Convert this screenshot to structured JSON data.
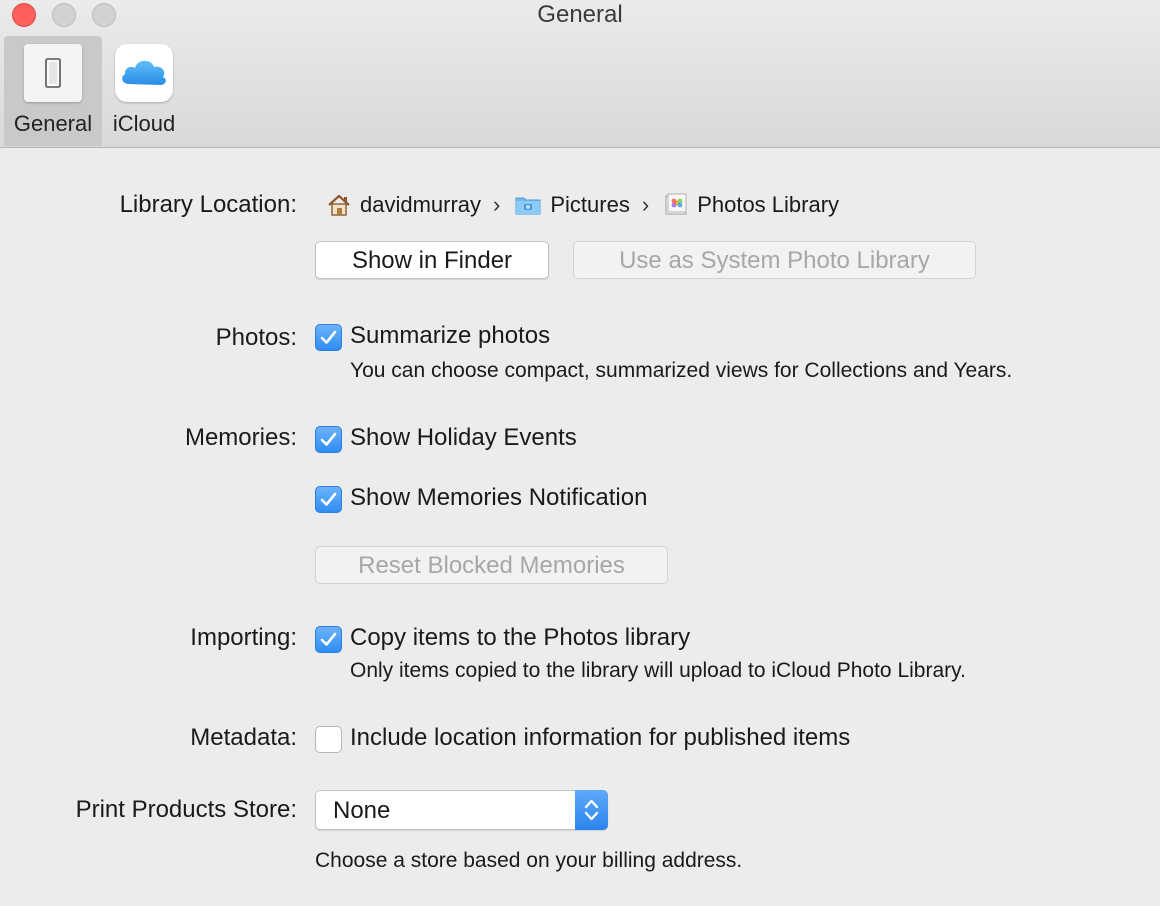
{
  "window": {
    "title": "General"
  },
  "toolbar": {
    "items": [
      {
        "label": "General",
        "icon": "switch-icon",
        "selected": true
      },
      {
        "label": "iCloud",
        "icon": "icloud-icon",
        "selected": false
      }
    ]
  },
  "library_location": {
    "label": "Library Location:",
    "path": [
      {
        "name": "davidmurray",
        "icon": "home-icon"
      },
      {
        "name": "Pictures",
        "icon": "pictures-folder-icon"
      },
      {
        "name": "Photos Library",
        "icon": "photos-library-icon"
      }
    ],
    "separator": "›",
    "show_in_finder": "Show in Finder",
    "use_as_system": "Use as System Photo Library"
  },
  "photos": {
    "label": "Photos:",
    "summarize_label": "Summarize photos",
    "summarize_checked": true,
    "summarize_note": "You can choose compact, summarized views for Collections and Years."
  },
  "memories": {
    "label": "Memories:",
    "holiday_label": "Show Holiday Events",
    "holiday_checked": true,
    "notification_label": "Show Memories Notification",
    "notification_checked": true,
    "reset_button": "Reset Blocked Memories"
  },
  "importing": {
    "label": "Importing:",
    "copy_label": "Copy items to the Photos library",
    "copy_checked": true,
    "copy_note": "Only items copied to the library will upload to iCloud Photo Library."
  },
  "metadata": {
    "label": "Metadata:",
    "location_label": "Include location information for published items",
    "location_checked": false
  },
  "print_store": {
    "label": "Print Products Store:",
    "selected": "None",
    "note": "Choose a store based on your billing address."
  },
  "colors": {
    "checkbox_blue": "#2f8cf4",
    "close_red": "#fc605c",
    "window_bg": "#ececec"
  }
}
